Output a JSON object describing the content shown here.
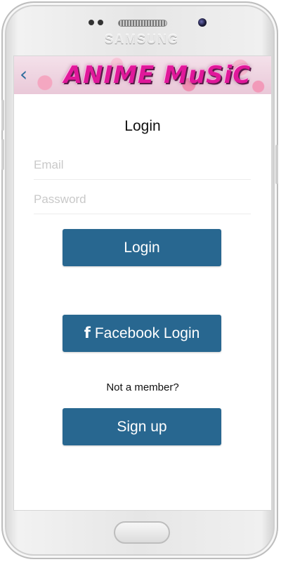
{
  "device": {
    "brand": "SAMSUNG"
  },
  "header": {
    "back_icon": "chevron-left-icon",
    "back_glyph": "‹",
    "banner_title": "ANIME MuSiC"
  },
  "login": {
    "title": "Login",
    "email_placeholder": "Email",
    "password_placeholder": "Password",
    "login_label": "Login",
    "facebook_icon": "facebook-icon",
    "facebook_glyph": "f",
    "facebook_label": "Facebook Login",
    "not_member_text": "Not a member?",
    "signup_label": "Sign up"
  },
  "colors": {
    "button_bg": "#286790",
    "button_text": "#ffffff",
    "accent": "#2f6e9d"
  }
}
